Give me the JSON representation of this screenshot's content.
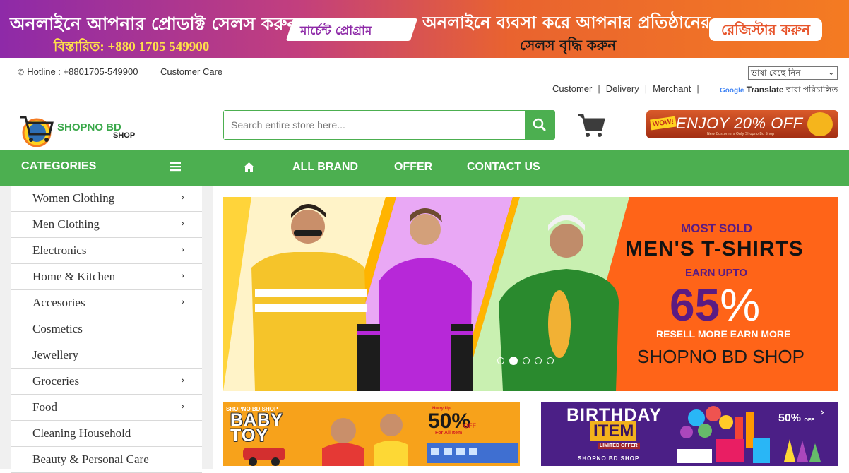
{
  "promo": {
    "line1": "অনলাইনে আপনার প্রোডাক্ট সেলস করুন",
    "line2": "বিস্তারিত: +880 1705 549900",
    "ribbon": "মার্চেন্ট প্রোগ্রাম",
    "line3": "অনলাইনে ব্যবসা করে আপনার প্রতিষ্ঠানের",
    "line4": "সেলস বৃদ্ধি করুন",
    "register": "রেজিস্টার করুন"
  },
  "topbar": {
    "hotline": "Hotline : +8801705-549900",
    "customer_care": "Customer Care",
    "language_select": "ভাষা বেছে নিন",
    "links": [
      "Customer",
      "Delivery",
      "Merchant"
    ],
    "google": "Google",
    "translate": "Translate",
    "powered": "দ্বারা পরিচালিত"
  },
  "header": {
    "logo_line1": "SHOPNO BD",
    "logo_line2": "SHOP",
    "search_placeholder": "Search entire store here...",
    "offer_badge": "WOW!",
    "offer_text": "ENJOY 20% OFF",
    "offer_sub": "New Customers Only Shopno Bd Shop"
  },
  "nav": {
    "categories": "CATEGORIES",
    "links": [
      "ALL BRAND",
      "OFFER",
      "CONTACT US"
    ]
  },
  "categories": [
    {
      "label": "Women Clothing",
      "has_sub": true
    },
    {
      "label": "Men Clothing",
      "has_sub": true
    },
    {
      "label": "Electronics",
      "has_sub": true
    },
    {
      "label": "Home & Kitchen",
      "has_sub": true
    },
    {
      "label": "Accesories",
      "has_sub": true
    },
    {
      "label": "Cosmetics",
      "has_sub": false
    },
    {
      "label": "Jewellery",
      "has_sub": false
    },
    {
      "label": "Groceries",
      "has_sub": true
    },
    {
      "label": "Food",
      "has_sub": true
    },
    {
      "label": "Cleaning Household",
      "has_sub": false
    },
    {
      "label": "Beauty & Personal Care",
      "has_sub": false
    }
  ],
  "hero": {
    "line1": "MOST SOLD",
    "line2": "MEN'S T-SHIRTS",
    "line3": "EARN UPTO",
    "number": "65",
    "percent": "%",
    "line5": "RESELL MORE EARN MORE",
    "line6": "SHOPNO BD SHOP",
    "dots": 5,
    "active_dot": 2
  },
  "banner_baby": {
    "top": "SHOPNO BD SHOP",
    "line1": "BABY",
    "line2": "TOY",
    "hurry": "Hurry Up!",
    "percent": "50%",
    "off": "OFF",
    "for_all": "For All Item"
  },
  "banner_birthday": {
    "line1": "BIRTHDAY",
    "line2": "ITEM",
    "limited": "LIMITED OFFER",
    "shop": "SHOPNO BD SHOP",
    "percent": "50%",
    "off": "OFF"
  },
  "colors": {
    "brand_green": "#4caf50",
    "promo_purple": "#8e2aa8",
    "promo_orange": "#f47b22",
    "hero_orange": "#ff6418"
  }
}
